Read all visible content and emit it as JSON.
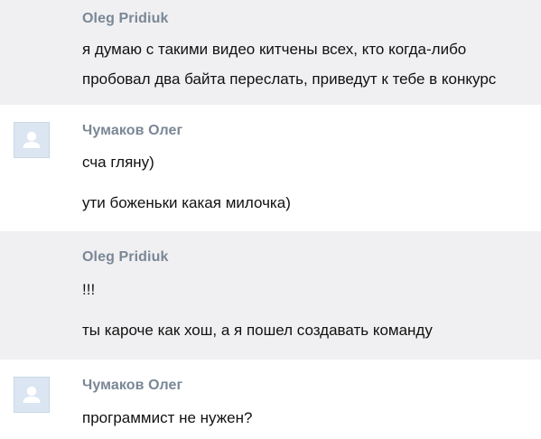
{
  "messages": [
    {
      "author": "Oleg Pridiuk",
      "has_avatar": false,
      "lines": [
        "я думаю с такими видео китчены всех, кто когда-либо",
        "пробовал два байта переслать, приведут к тебе в конкурс"
      ]
    },
    {
      "author": "Чумаков Олег",
      "has_avatar": true,
      "lines": [
        "сча гляну)",
        "ути боженьки какая милочка)"
      ]
    },
    {
      "author": "Oleg Pridiuk",
      "has_avatar": false,
      "lines": [
        "!!!",
        "ты кароче как хош, а я пошел создавать команду"
      ]
    },
    {
      "author": "Чумаков Олег",
      "has_avatar": true,
      "lines": [
        "программист не нужен?"
      ]
    }
  ],
  "colors": {
    "shaded_background": "#f0f0f2",
    "author_text": "#7a8796",
    "message_text": "#111111",
    "avatar_fill": "#dbe6f2"
  },
  "icons": {
    "avatar": "user-silhouette-icon"
  }
}
